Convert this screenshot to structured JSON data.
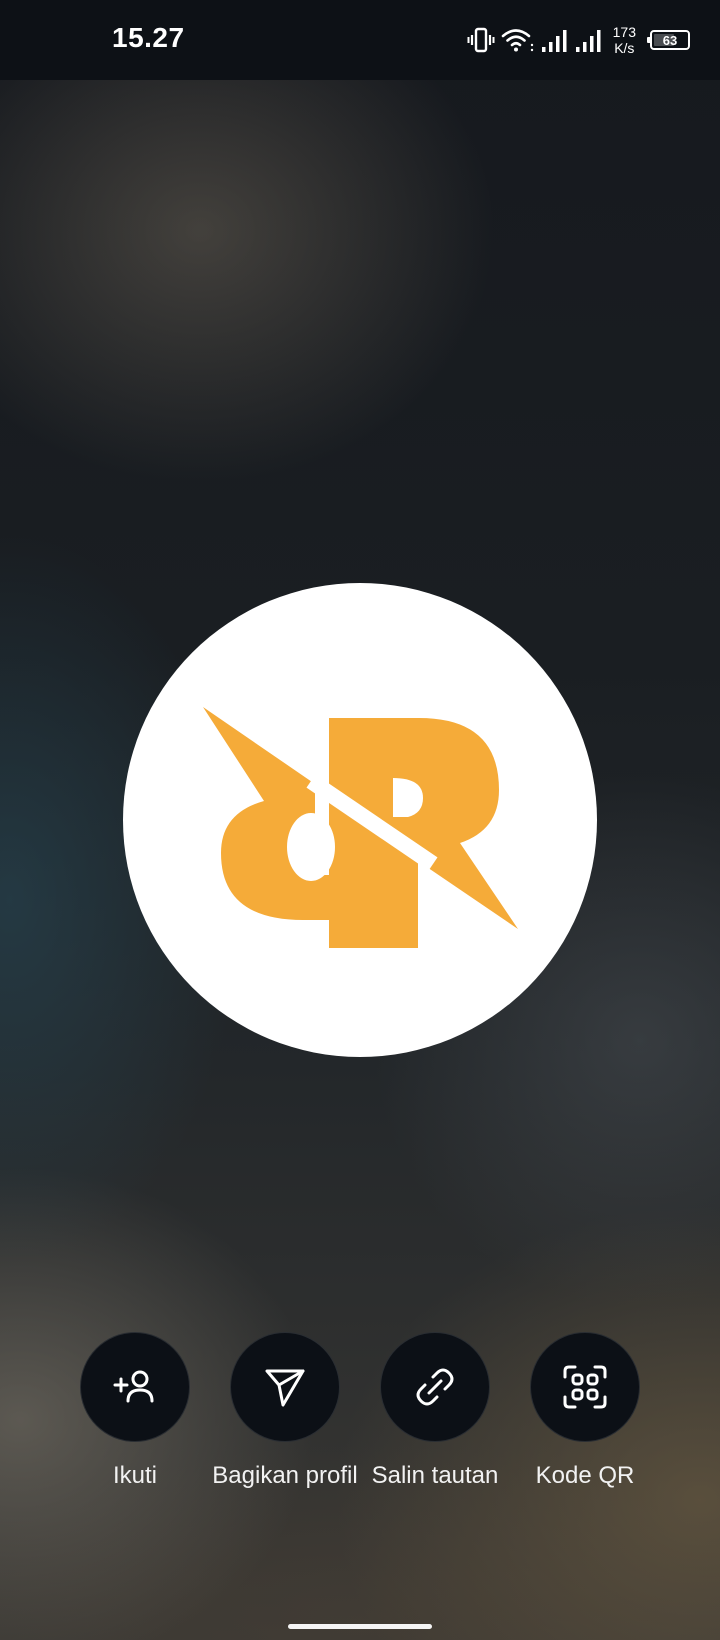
{
  "status_bar": {
    "time": "15.27",
    "net_speed_value": "173",
    "net_speed_unit": "K/s",
    "battery_level": "63",
    "icons": [
      "vibrate-icon",
      "wifi-icon",
      "signal-icon",
      "signal-icon"
    ]
  },
  "profile": {
    "avatar_icon": "rrq-logo-icon",
    "brand_color": "#f5ab39"
  },
  "actions": [
    {
      "label": "Ikuti",
      "icon": "add-person-icon"
    },
    {
      "label": "Bagikan profil",
      "icon": "send-icon"
    },
    {
      "label": "Salin tautan",
      "icon": "link-icon"
    },
    {
      "label": "Kode QR",
      "icon": "qr-code-icon"
    }
  ]
}
